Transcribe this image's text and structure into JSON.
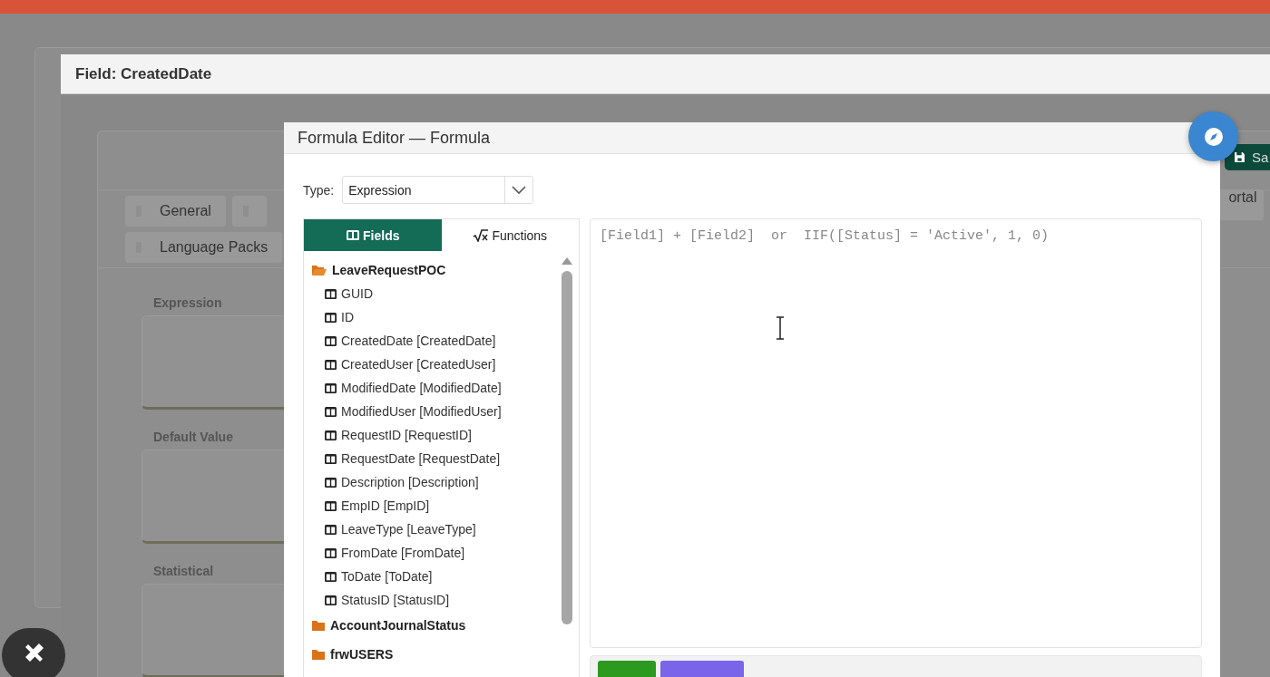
{
  "field_dialog": {
    "title": "Field: CreatedDate",
    "save_button": "Sa",
    "tabs": [
      {
        "label": "General"
      },
      {
        "label": "Language Packs"
      },
      {
        "label": "ortal"
      }
    ],
    "sections": [
      {
        "label": "Expression"
      },
      {
        "label": "Default Value"
      },
      {
        "label": "Statistical"
      }
    ]
  },
  "formula_editor": {
    "title": "Formula Editor — Formula",
    "type_label": "Type:",
    "type_value": "Expression",
    "tabs": [
      {
        "label": "Fields",
        "kind": "fields",
        "selected": true
      },
      {
        "label": "Functions",
        "kind": "functions",
        "selected": false
      }
    ],
    "tree": [
      {
        "label": "LeaveRequestPOC",
        "expanded": true,
        "children": [
          {
            "label": "GUID"
          },
          {
            "label": "ID"
          },
          {
            "label": "CreatedDate [CreatedDate]"
          },
          {
            "label": "CreatedUser [CreatedUser]"
          },
          {
            "label": "ModifiedDate [ModifiedDate]"
          },
          {
            "label": "ModifiedUser [ModifiedUser]"
          },
          {
            "label": "RequestID [RequestID]"
          },
          {
            "label": "RequestDate [RequestDate]"
          },
          {
            "label": "Description [Description]"
          },
          {
            "label": "EmpID [EmpID]"
          },
          {
            "label": "LeaveType [LeaveType]"
          },
          {
            "label": "FromDate [FromDate]"
          },
          {
            "label": "ToDate [ToDate]"
          },
          {
            "label": "StatusID [StatusID]"
          }
        ]
      },
      {
        "label": "AccountJournalStatus",
        "expanded": false
      },
      {
        "label": "frwUSERS",
        "expanded": false
      }
    ],
    "editor": {
      "placeholder": "[Field1] + [Field2]  or  IIF([Status] = 'Active', 1, 0)"
    }
  }
}
